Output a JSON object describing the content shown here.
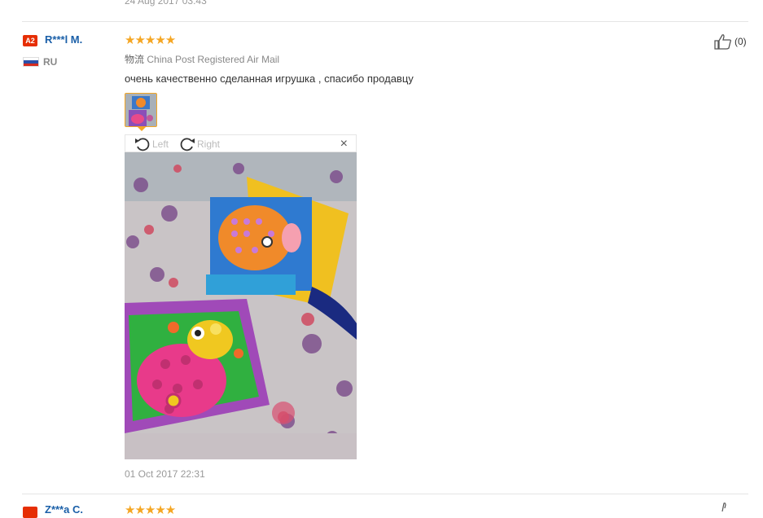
{
  "previous_review": {
    "date": "24 Aug 2017 03:43"
  },
  "review": {
    "level_badge": "A2",
    "user_name": "R***l M.",
    "country": "RU",
    "stars": "★★★★★",
    "rating": 5,
    "shipping_label": "物流",
    "shipping_method": "China Post Registered Air Mail",
    "text": "очень качественно сделанная игрушка , спасибо продавцу",
    "helpful_count": "(0)",
    "date": "01 Oct 2017 22:31"
  },
  "viewer": {
    "rotate_left_label": "Left",
    "rotate_right_label": "Right",
    "close_glyph": "×"
  },
  "next_review": {
    "user_name": "Z***a C.",
    "stars": "★★★★★"
  },
  "colors": {
    "accent": "#f5a623",
    "badge": "#e62e04",
    "username": "#1a5fa8"
  }
}
